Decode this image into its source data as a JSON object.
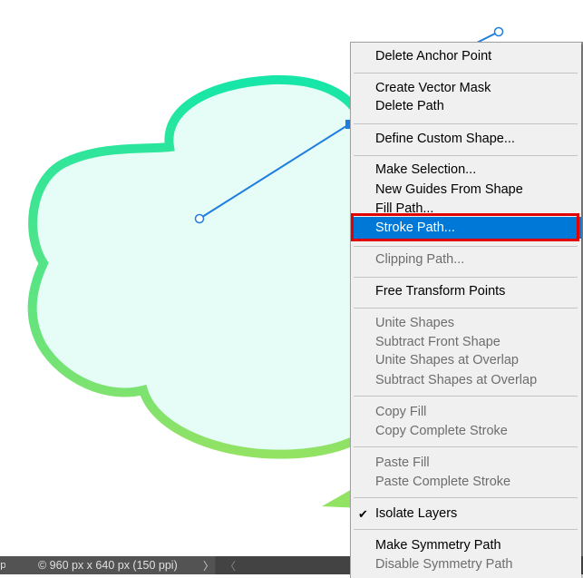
{
  "canvas": {
    "shape": "cloud-callout",
    "fill_color": "#e6fcf7",
    "stroke_gradient_top": "#16e6a8",
    "stroke_gradient_bottom": "#92e264",
    "path_line_color": "#1e7ee0",
    "anchor_fill": "#ffffff"
  },
  "status_bar": {
    "left_stub": "p",
    "doc_info": "© 960 px x 640 px (150 ppi)",
    "nav_right_glyph": "〉",
    "nav_left_glyph": "〈"
  },
  "context_menu": {
    "items": [
      {
        "label": "Delete Anchor Point",
        "enabled": true
      },
      {
        "label": "Create Vector Mask",
        "enabled": true
      },
      {
        "label": "Delete Path",
        "enabled": true
      },
      {
        "label": "Define Custom Shape...",
        "enabled": true
      },
      {
        "label": "Make Selection...",
        "enabled": true
      },
      {
        "label": "New Guides From Shape",
        "enabled": true
      },
      {
        "label": "Fill Path...",
        "enabled": true
      },
      {
        "label": "Stroke Path...",
        "enabled": true,
        "highlighted": true
      },
      {
        "label": "Clipping Path...",
        "enabled": false
      },
      {
        "label": "Free Transform Points",
        "enabled": true
      },
      {
        "label": "Unite Shapes",
        "enabled": false
      },
      {
        "label": "Subtract Front Shape",
        "enabled": false
      },
      {
        "label": "Unite Shapes at Overlap",
        "enabled": false
      },
      {
        "label": "Subtract Shapes at Overlap",
        "enabled": false
      },
      {
        "label": "Copy Fill",
        "enabled": false
      },
      {
        "label": "Copy Complete Stroke",
        "enabled": false
      },
      {
        "label": "Paste Fill",
        "enabled": false
      },
      {
        "label": "Paste Complete Stroke",
        "enabled": false
      },
      {
        "label": "Isolate Layers",
        "enabled": true,
        "checked": true
      },
      {
        "label": "Make Symmetry Path",
        "enabled": true
      },
      {
        "label": "Disable Symmetry Path",
        "enabled": false
      }
    ],
    "check_glyph": "✔",
    "highlight_color": "#0078d7",
    "annotation_color": "#e30000"
  }
}
